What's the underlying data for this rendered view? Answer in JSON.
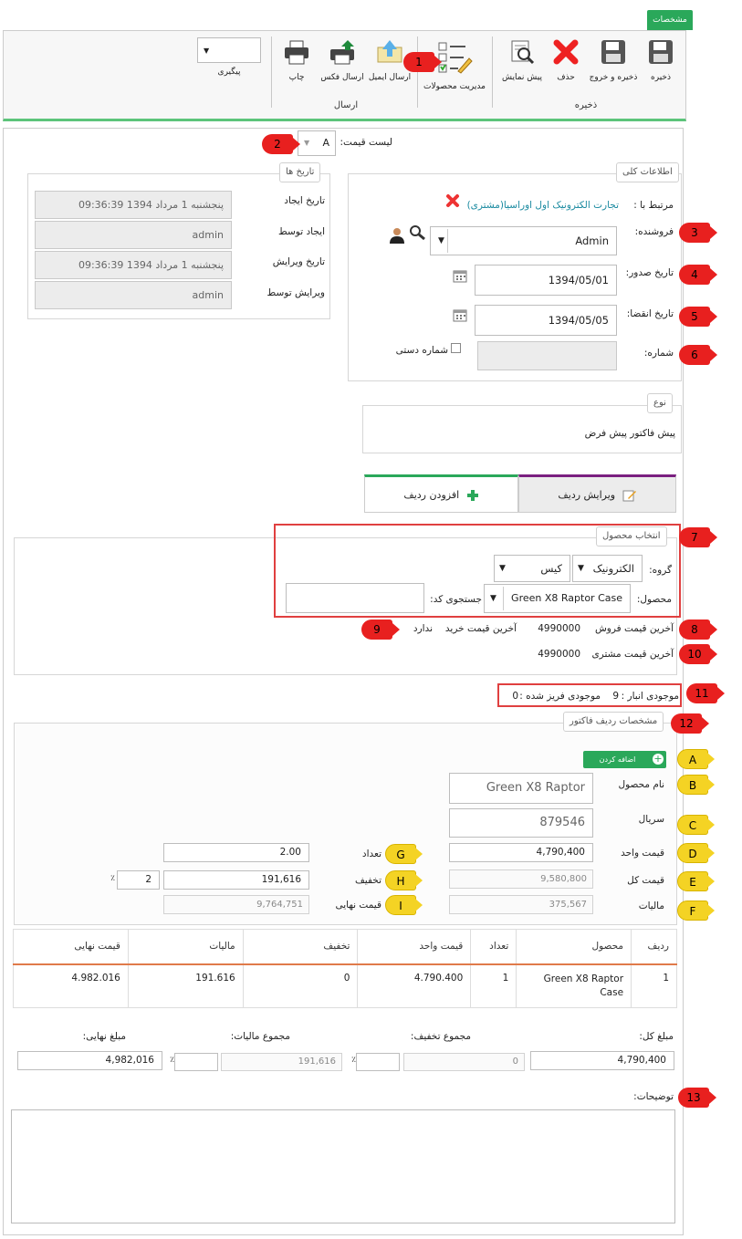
{
  "ribbon": {
    "tab_label": "مشخصات",
    "buttons": {
      "save": "ذخیره",
      "save_exit": "ذخیره و خروج",
      "delete": "حذف",
      "preview": "پیش نمایش",
      "products": "مدیریت محصولات",
      "email": "ارسال ایمیل",
      "fax": "ارسال فکس",
      "print": "چاپ",
      "followup": "پیگیری"
    },
    "groups": {
      "save": "ذخیره",
      "send": "ارسال"
    }
  },
  "price_list": {
    "label": "لیست قیمت:",
    "value": "A"
  },
  "dates": {
    "legend": "تاریخ ها",
    "created_label": "تاریخ ایجاد",
    "created_value": "پنجشنبه 1 مرداد 1394 09:36:39",
    "created_by_label": "ایجاد توسط",
    "created_by_value": "admin",
    "edited_label": "تاریخ ویرایش",
    "edited_value": "پنجشنبه 1 مرداد 1394 09:36:39",
    "edited_by_label": "ویرایش توسط",
    "edited_by_value": "admin"
  },
  "general": {
    "legend": "اطلاعات کلی",
    "related_label": "مرتبط با :",
    "related_value": "تجارت الکترونیک اول اوراسیا(مشتری)",
    "seller_label": "فروشنده:",
    "seller_value": "Admin",
    "issue_label": "تاریخ صدور:",
    "issue_value": "1394/05/01",
    "expire_label": "تاریخ انقضا:",
    "expire_value": "1394/05/05",
    "number_label": "شماره:",
    "manual_label": "شماره دستی"
  },
  "type": {
    "legend": "نوع",
    "value": "پیش فاکتور پیش فرض"
  },
  "tabs": {
    "edit": "ویرایش ردیف",
    "add": "افزودن ردیف"
  },
  "product_select": {
    "legend": "انتخاب محصول",
    "group_label": "گروه:",
    "group_value": "الکترونیک",
    "subgroup_value": "کیس",
    "product_label": "محصول:",
    "product_value": "Green X8 Raptor Case",
    "search_label": "جستجوی کد:",
    "last_sale_label": "آخرین قیمت فروش",
    "last_sale_value": "4990000",
    "last_buy_label": "آخرین قیمت خرید",
    "last_buy_value": "ندارد",
    "last_customer_label": "آخرین قیمت مشتری",
    "last_customer_value": "4990000"
  },
  "stock": {
    "label": "موجودی انبار :",
    "value": "9",
    "frozen_label": "موجودی فریز شده :",
    "frozen_value": "0"
  },
  "row_spec": {
    "legend": "مشخصات ردیف فاکتور",
    "add_button": "اضافه کردن",
    "name_label": "نام محصول",
    "name_value": "Green X8 Raptor Case",
    "serial_label": "سریال",
    "serial_value": "879546",
    "unit_price_label": "قیمت واحد",
    "unit_price_value": "4,790,400",
    "total_label": "قیمت کل",
    "total_value": "9,580,800",
    "tax_label": "مالیات",
    "tax_value": "375,567",
    "qty_label": "تعداد",
    "qty_value": "2.00",
    "discount_label": "تخفیف",
    "discount_value": "191,616",
    "discount_pct": "2",
    "pct_sign": "٪",
    "final_label": "قیمت نهایی",
    "final_value": "9,764,751"
  },
  "grid": {
    "headers": [
      "ردیف",
      "محصول",
      "تعداد",
      "قیمت واحد",
      "تخفیف",
      "مالیات",
      "قیمت نهایی"
    ],
    "rows": [
      [
        "1",
        "Green X8 Raptor Case",
        "1",
        "4.790.400",
        "0",
        "191.616",
        "4.982.016"
      ]
    ]
  },
  "totals": {
    "sum_label": "مبلغ کل:",
    "sum_value": "4,790,400",
    "discount_label": "مجموع تخفیف:",
    "discount_value": "0",
    "tax_label": "مجموع مالیات:",
    "tax_value": "191,616",
    "final_label": "مبلغ نهایی:",
    "final_value": "4,982,016",
    "pct_sign": "٪"
  },
  "notes": {
    "label": "توضیحات:",
    "value": ""
  },
  "markers": {
    "m1": "1",
    "m2": "2",
    "m3": "3",
    "m4": "4",
    "m5": "5",
    "m6": "6",
    "m7": "7",
    "m8": "8",
    "m9": "9",
    "m10": "10",
    "m11": "11",
    "m12": "12",
    "m13": "13",
    "a": "A",
    "b": "B",
    "c": "C",
    "d": "D",
    "e": "E",
    "f": "F",
    "g": "G",
    "h": "H",
    "i": "I"
  }
}
